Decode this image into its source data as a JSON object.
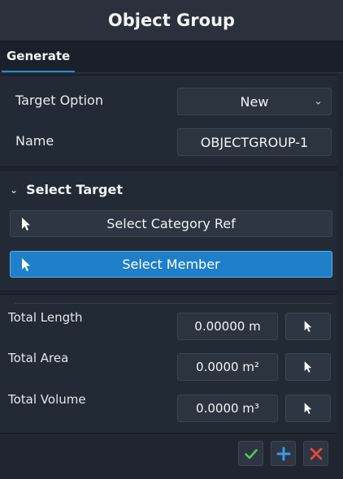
{
  "title": "Object Group",
  "tabs": [
    {
      "label": "Generate",
      "active": true
    }
  ],
  "form": {
    "target_option": {
      "label": "Target Option",
      "value": "New"
    },
    "name": {
      "label": "Name",
      "value": "OBJECTGROUP-1"
    }
  },
  "select_target": {
    "heading": "Select Target",
    "category_button": "Select Category Ref",
    "member_button": "Select Member"
  },
  "totals": [
    {
      "label": "Total Length",
      "value": "0.00000 m"
    },
    {
      "label": "Total Area",
      "value": "0.0000 m²"
    },
    {
      "label": "Total Volume",
      "value": "0.0000 m³"
    }
  ],
  "colors": {
    "accent": "#1f7fc8",
    "confirm": "#5cc35c",
    "add": "#3d9be8",
    "cancel": "#e24a3b"
  },
  "icons": {
    "pointer": "cursor-arrow",
    "confirm": "checkmark",
    "add": "plus",
    "cancel": "x"
  }
}
